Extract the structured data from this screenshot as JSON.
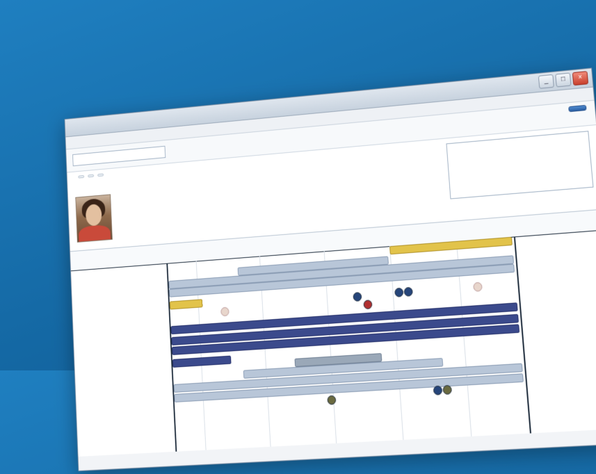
{
  "window": {
    "title": "",
    "controls": {
      "min": "_",
      "max": "□",
      "close": "×"
    }
  },
  "menubar": {
    "items": [
      "",
      "",
      "",
      "",
      "",
      "",
      ""
    ]
  },
  "toolbar": {
    "primary_button": ""
  },
  "patient": {
    "name": "",
    "tabs": [
      "",
      "",
      ""
    ],
    "notes_label": "",
    "notes_text": ""
  },
  "timeline": {
    "legend": [
      "",
      ""
    ],
    "months": [
      "",
      ""
    ],
    "categories": [
      {
        "label": "",
        "date": ""
      },
      {
        "label": "",
        "date": ""
      },
      {
        "label": "",
        "date": ""
      },
      {
        "label": "",
        "date": ""
      },
      {
        "label": "",
        "date": ""
      },
      {
        "label": "",
        "date": ""
      }
    ]
  },
  "colors": {
    "background": "#156aa6",
    "bar_light": "#b8c6d8",
    "bar_navy": "#3b4a8c",
    "bar_gold": "#e2c34a",
    "event_blue": "#26457a",
    "event_red": "#b23030"
  }
}
